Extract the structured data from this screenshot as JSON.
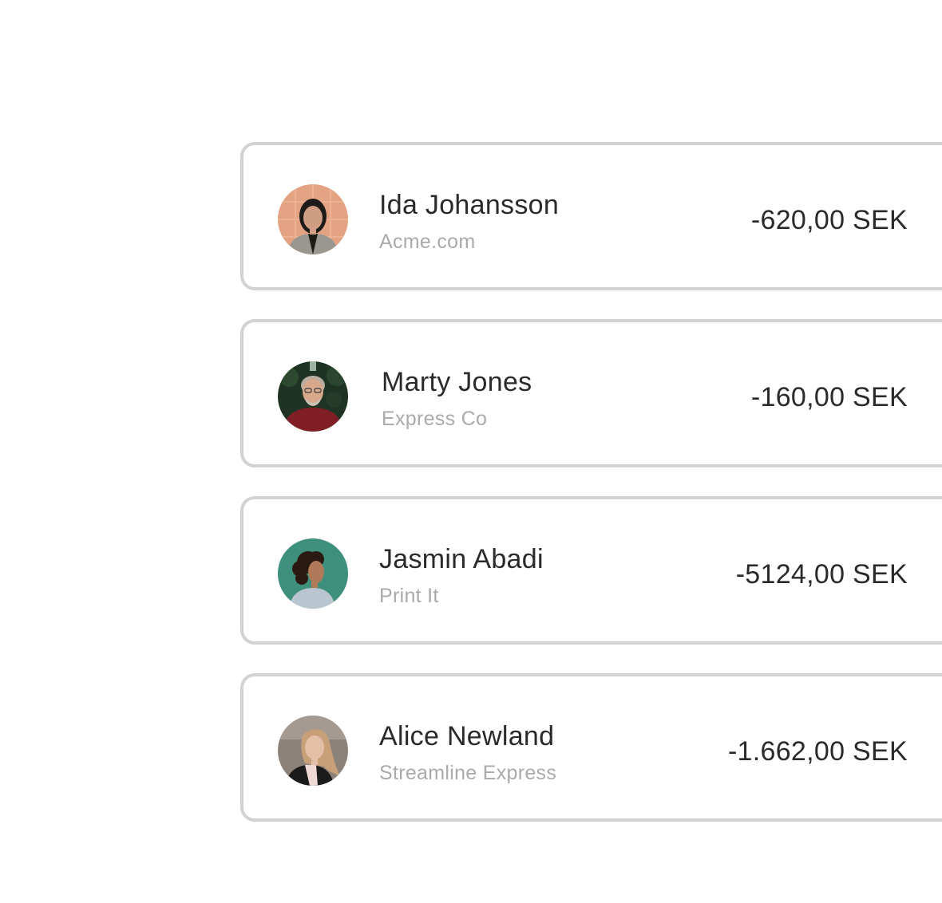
{
  "transactions": [
    {
      "name": "Ida Johansson",
      "company": "Acme.com",
      "amount": "-620,00 SEK",
      "avatar": {
        "icon": "person-photo-icon",
        "background": "#e3a382",
        "hair": "#1e1a17",
        "skin": "#cf9e82",
        "clothing": "#9a9690"
      }
    },
    {
      "name": "Marty Jones",
      "company": "Express Co",
      "amount": "-160,00 SEK",
      "avatar": {
        "icon": "person-photo-icon",
        "background": "#1f3324",
        "hair": "#b9aea0",
        "skin": "#d8a88d",
        "clothing": "#7f1e24"
      }
    },
    {
      "name": "Jasmin Abadi",
      "company": "Print It",
      "amount": "-5124,00 SEK",
      "avatar": {
        "icon": "person-photo-icon",
        "background": "#3e8f7b",
        "hair": "#2a1a12",
        "skin": "#b07a5a",
        "clothing": "#b9c6cf"
      }
    },
    {
      "name": "Alice Newland",
      "company": "Streamline Express",
      "amount": "-1.662,00 SEK",
      "avatar": {
        "icon": "person-photo-icon",
        "background": "#8d8279",
        "hair": "#c7a07a",
        "skin": "#e2bfa6",
        "clothing": "#1b1b1b"
      }
    }
  ]
}
